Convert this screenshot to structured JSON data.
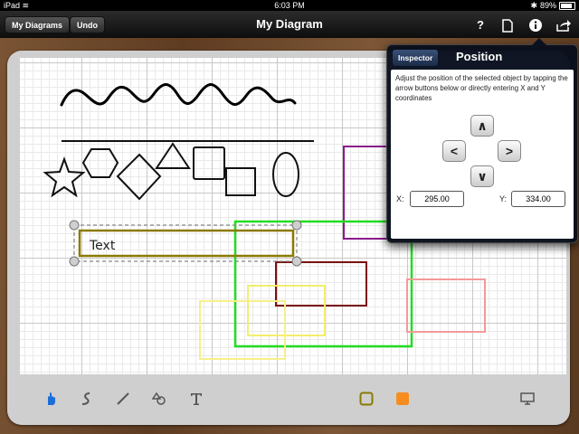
{
  "status": {
    "device": "iPad",
    "time": "6:03 PM",
    "battery": "89%"
  },
  "nav": {
    "left_button": "My Diagrams",
    "undo_button": "Undo",
    "title": "My Diagram",
    "help_icon": "?"
  },
  "inspector": {
    "tab_button": "Inspector",
    "title": "Position",
    "description": "Adjust the position of the selected object by tapping the arrow buttons below or directly entering X and Y coordinates",
    "x_label": "X:",
    "y_label": "Y:",
    "x_value": "295.00",
    "y_value": "334.00"
  },
  "canvas": {
    "text_object": "Text"
  },
  "colors": {
    "stroke_color": "#8a7a00",
    "fill_color": "#f78d1f",
    "selected_tool": "#1d6fd8"
  },
  "icons": [
    "hand-icon",
    "freehand-icon",
    "line-icon",
    "shapes-icon",
    "text-tool-icon",
    "stroke-color-icon",
    "fill-color-icon",
    "present-icon"
  ]
}
